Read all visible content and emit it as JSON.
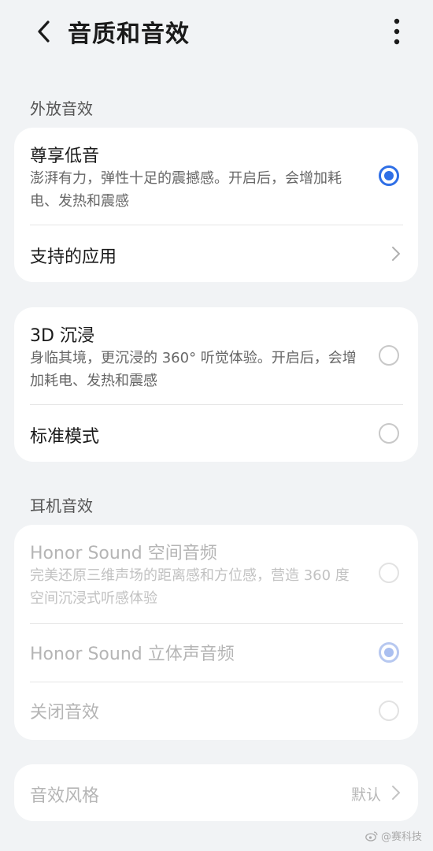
{
  "header": {
    "title": "音质和音效",
    "back_icon": "chevron-left-icon",
    "more_icon": "more-vertical-icon"
  },
  "sections": {
    "speaker_label": "外放音效",
    "headphone_label": "耳机音效"
  },
  "speaker_card": {
    "bass_title": "尊享低音",
    "bass_desc": "澎湃有力，弹性十足的震撼感。开启后，会增加耗电、发热和震感",
    "bass_selected": true,
    "supported_apps": "支持的应用"
  },
  "mode_card": {
    "immersive_title": "3D 沉浸",
    "immersive_desc": "身临其境，更沉浸的 360° 听觉体验。开启后，会增加耗电、发热和震感",
    "immersive_selected": false,
    "standard_title": "标准模式",
    "standard_selected": false
  },
  "headphone_card": {
    "spatial_title": "Honor Sound 空间音频",
    "spatial_desc": "完美还原三维声场的距离感和方位感，营造 360 度空间沉浸式听感体验",
    "spatial_selected": false,
    "stereo_title": "Honor Sound 立体声音频",
    "stereo_selected": true,
    "off_title": "关闭音效",
    "off_selected": false,
    "enabled": false
  },
  "style_card": {
    "label": "音效风格",
    "value": "默认"
  },
  "watermark": "@赛科技",
  "colors": {
    "accent": "#2f6fe6",
    "background": "#f1f3f5",
    "card": "#ffffff"
  }
}
